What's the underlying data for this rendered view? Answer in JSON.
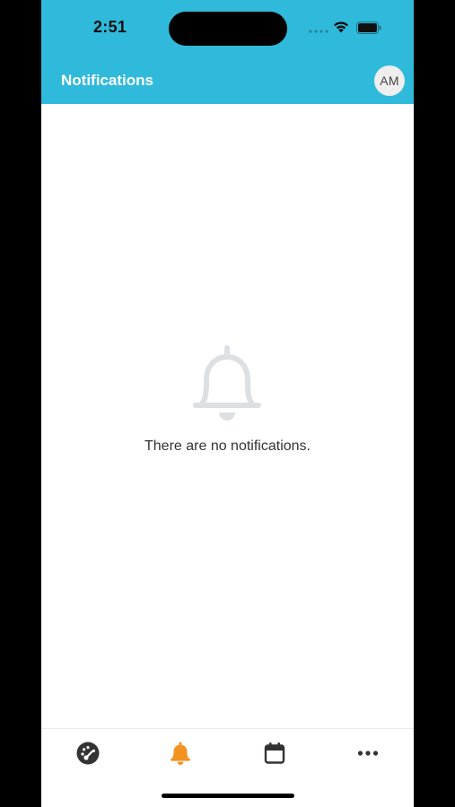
{
  "status_bar": {
    "time": "2:51"
  },
  "header": {
    "title": "Notifications",
    "avatar_initials": "AM"
  },
  "main": {
    "empty_icon": "bell-icon",
    "empty_message": "There are no notifications."
  },
  "tab_bar": {
    "tabs": [
      {
        "icon": "dashboard-gauge-icon",
        "active": false
      },
      {
        "icon": "bell-icon",
        "active": true
      },
      {
        "icon": "calendar-icon",
        "active": false
      },
      {
        "icon": "more-dots-icon",
        "active": false
      }
    ]
  },
  "colors": {
    "header_bg": "#2FBADC",
    "active_tab": "#F39221",
    "inactive_tab": "#333333",
    "empty_icon": "#DDE0E3"
  }
}
